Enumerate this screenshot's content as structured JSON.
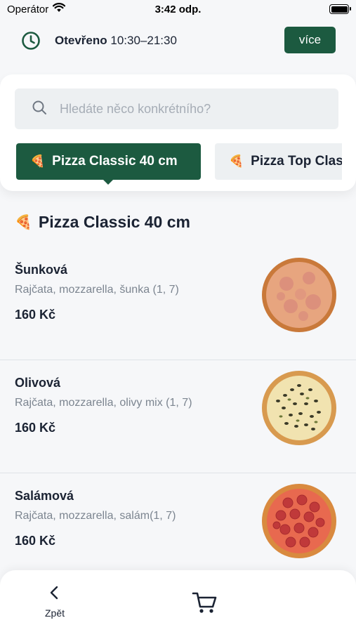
{
  "status_bar": {
    "carrier": "Operátor",
    "time": "3:42 odp.",
    "icons": [
      "wifi-icon",
      "battery-icon"
    ]
  },
  "hours": {
    "label": "Otevřeno",
    "value": "10:30–21:30",
    "icon": "clock-icon"
  },
  "more_button_label": "více",
  "search": {
    "placeholder": "Hledáte něco konkrétního?",
    "value": "",
    "icon": "search-icon"
  },
  "categories": [
    {
      "emoji": "🍕",
      "label": "Pizza Classic 40 cm",
      "active": true
    },
    {
      "emoji": "🍕",
      "label": "Pizza Top Classic",
      "active": false
    }
  ],
  "section": {
    "emoji": "🍕",
    "title": "Pizza Classic 40 cm"
  },
  "items": [
    {
      "name": "Šunková",
      "description": "Rajčata, mozzarella, šunka (1, 7)",
      "price": "160 Kč",
      "image": "pizza-ham-image"
    },
    {
      "name": "Olivová",
      "description": "Rajčata, mozzarella, olivy mix (1, 7)",
      "price": "160 Kč",
      "image": "pizza-olive-image"
    },
    {
      "name": "Salámová",
      "description": "Rajčata, mozzarella, salám(1, 7)",
      "price": "160 Kč",
      "image": "pizza-salami-image"
    }
  ],
  "bottom_bar": {
    "back_label": "Zpět",
    "back_icon": "chevron-left-icon",
    "cart_icon": "cart-icon"
  },
  "colors": {
    "accent": "#1c5a40",
    "background": "#f6f7f9",
    "text": "#1b2333",
    "muted": "#7c8590"
  }
}
